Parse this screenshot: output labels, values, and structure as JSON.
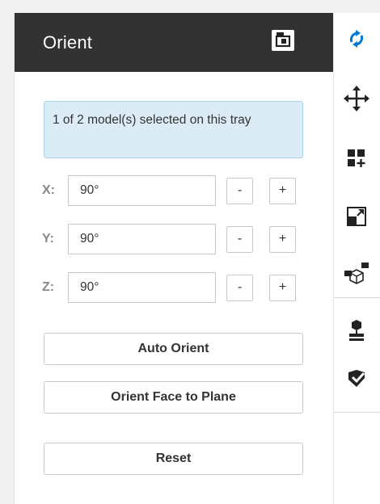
{
  "panel": {
    "title": "Orient",
    "pin_icon": "pin-panel-icon",
    "selection_info": "1 of 2 model(s) selected on this tray",
    "axes": [
      {
        "label": "X:",
        "value": "90°",
        "minus": "-",
        "plus": "+"
      },
      {
        "label": "Y:",
        "value": "90°",
        "minus": "-",
        "plus": "+"
      },
      {
        "label": "Z:",
        "value": "90°",
        "minus": "-",
        "plus": "+"
      }
    ],
    "auto_orient_label": "Auto Orient",
    "orient_face_label": "Orient Face to Plane",
    "reset_label": "Reset"
  },
  "toolbar": {
    "tools": [
      "orient-icon",
      "move-icon",
      "arrange-icon",
      "scale-icon",
      "supports-icon",
      "print-prep-icon",
      "check-icon"
    ],
    "active_color": "#0078d4"
  },
  "colors": {
    "header_bg": "#323232",
    "info_bg": "#dcecf6",
    "info_border": "#a8d1ea"
  }
}
